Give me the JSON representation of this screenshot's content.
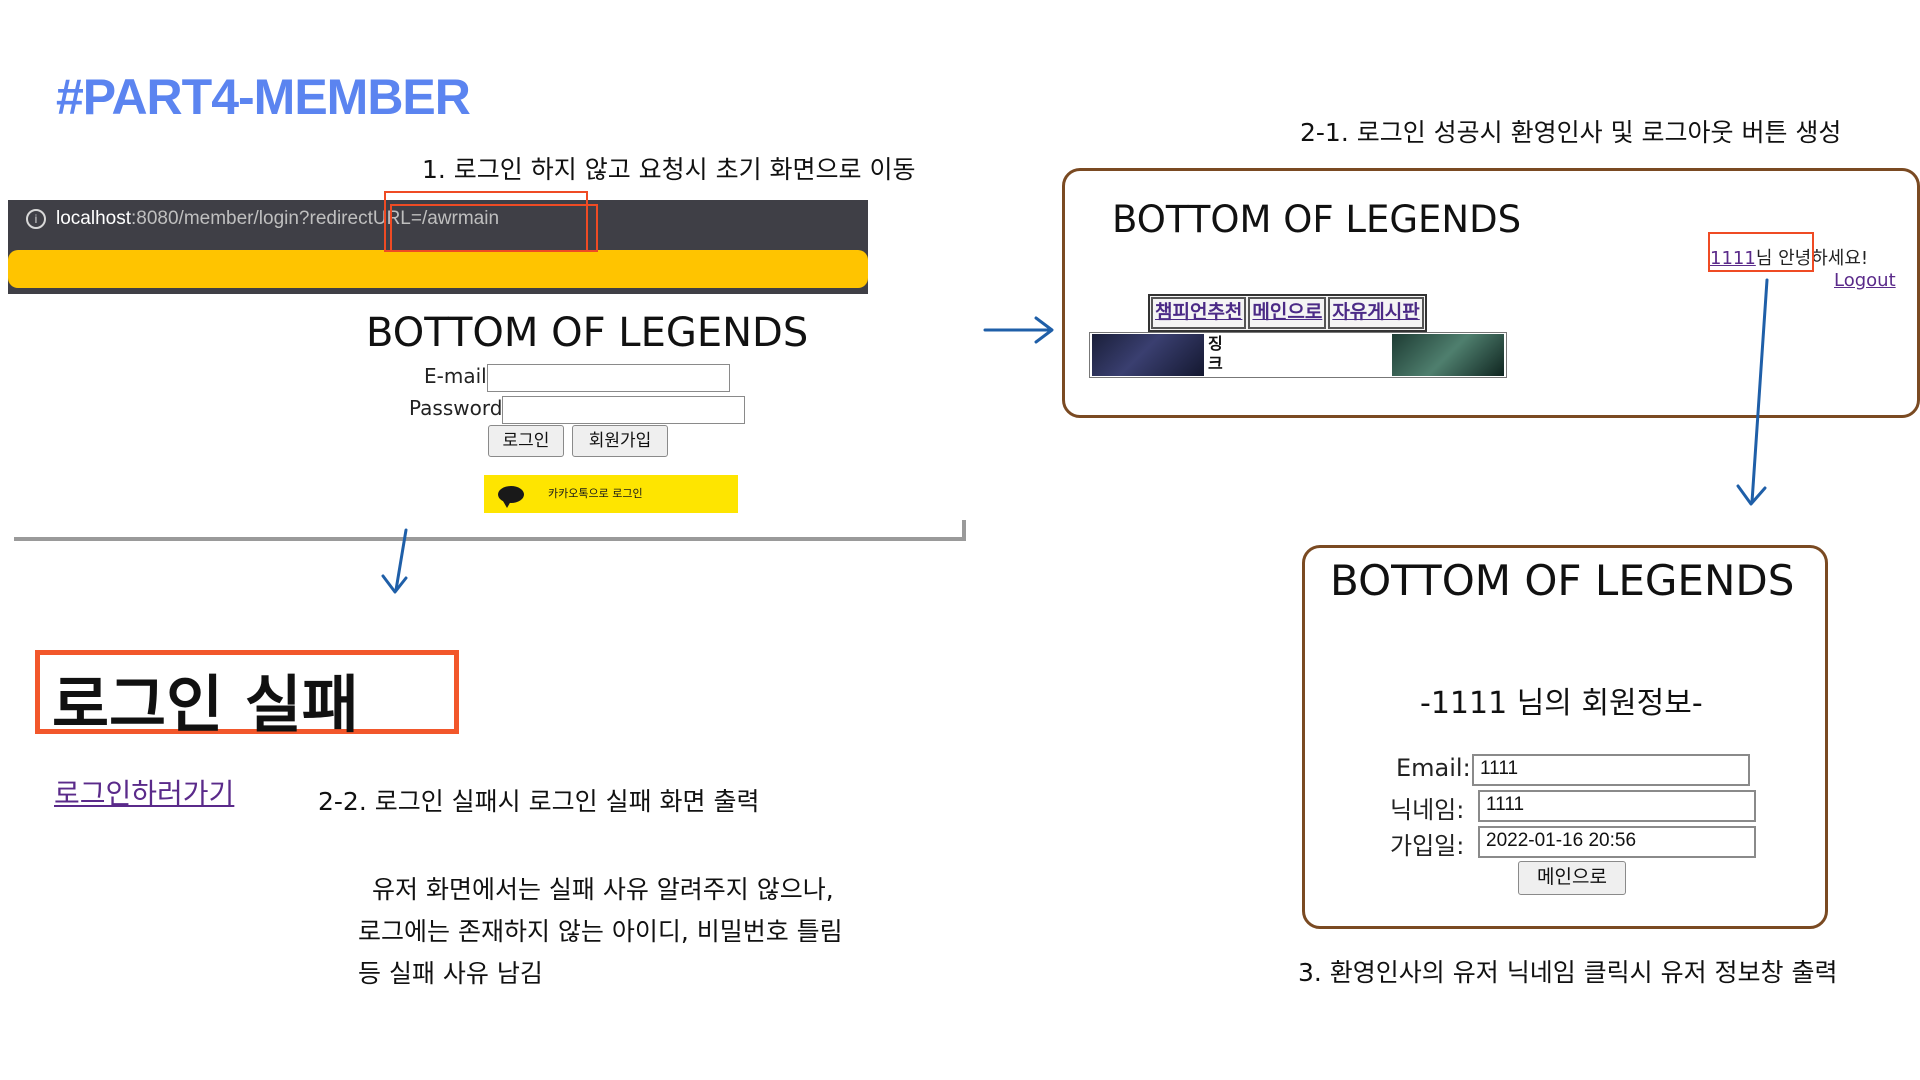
{
  "page": {
    "title": "#PART4-MEMBER",
    "brand": "BOTTOM OF LEGENDS"
  },
  "colors": {
    "title_blue": "#5b84f0",
    "highlight_red": "#ef4b24",
    "frame_brown": "#7a4a22",
    "arrow_blue": "#1f5fa8",
    "kakao_yellow": "#fee500",
    "browser_yellow": "#ffc400"
  },
  "captions": {
    "step1": "1. 로그인 하지 않고 요청시 초기 화면으로 이동",
    "step2_1": "2-1. 로그인 성공시 환영인사 및 로그아웃 버튼 생성",
    "step2_2": "2-2. 로그인 실패시 로그인 실패 화면 출력",
    "note_line1": "유저 화면에서는 실패 사유 알려주지 않으나,",
    "note_line2": "로그에는 존재하지 않는 아이디, 비밀번호 틀림",
    "note_line3": "등 실패 사유 남김",
    "step3": "3. 환영인사의 유저 닉네임 클릭시 유저 정보창 출력"
  },
  "login_screen": {
    "url_host": "localhost",
    "url_path": ":8080/member/login?redirectURL=/awrmain",
    "email_label": "E-mail",
    "password_label": "Password",
    "email_value": "",
    "password_value": "",
    "login_button": "로그인",
    "signup_button": "회원가입",
    "kakao_button": "카카오톡으로 로그인",
    "info_icon": "info-icon"
  },
  "success_screen": {
    "nav_items": [
      "챔피언추천",
      "메인으로",
      "자유게시판"
    ],
    "welcome_user": "1111",
    "welcome_text": "님 안녕하세요!",
    "logout_link": "Logout",
    "champion_name_line1": "징",
    "champion_name_line2": "크"
  },
  "fail_screen": {
    "heading": "로그인 실패",
    "link": "로그인하러가기"
  },
  "info_screen": {
    "heading": "-1111 님의 회원정보-",
    "email_label": "Email:",
    "email_value": "1111",
    "nickname_label": "닉네임:",
    "nickname_value": "1111",
    "joined_label": "가입일:",
    "joined_value": "2022-01-16 20:56",
    "main_button": "메인으로"
  }
}
